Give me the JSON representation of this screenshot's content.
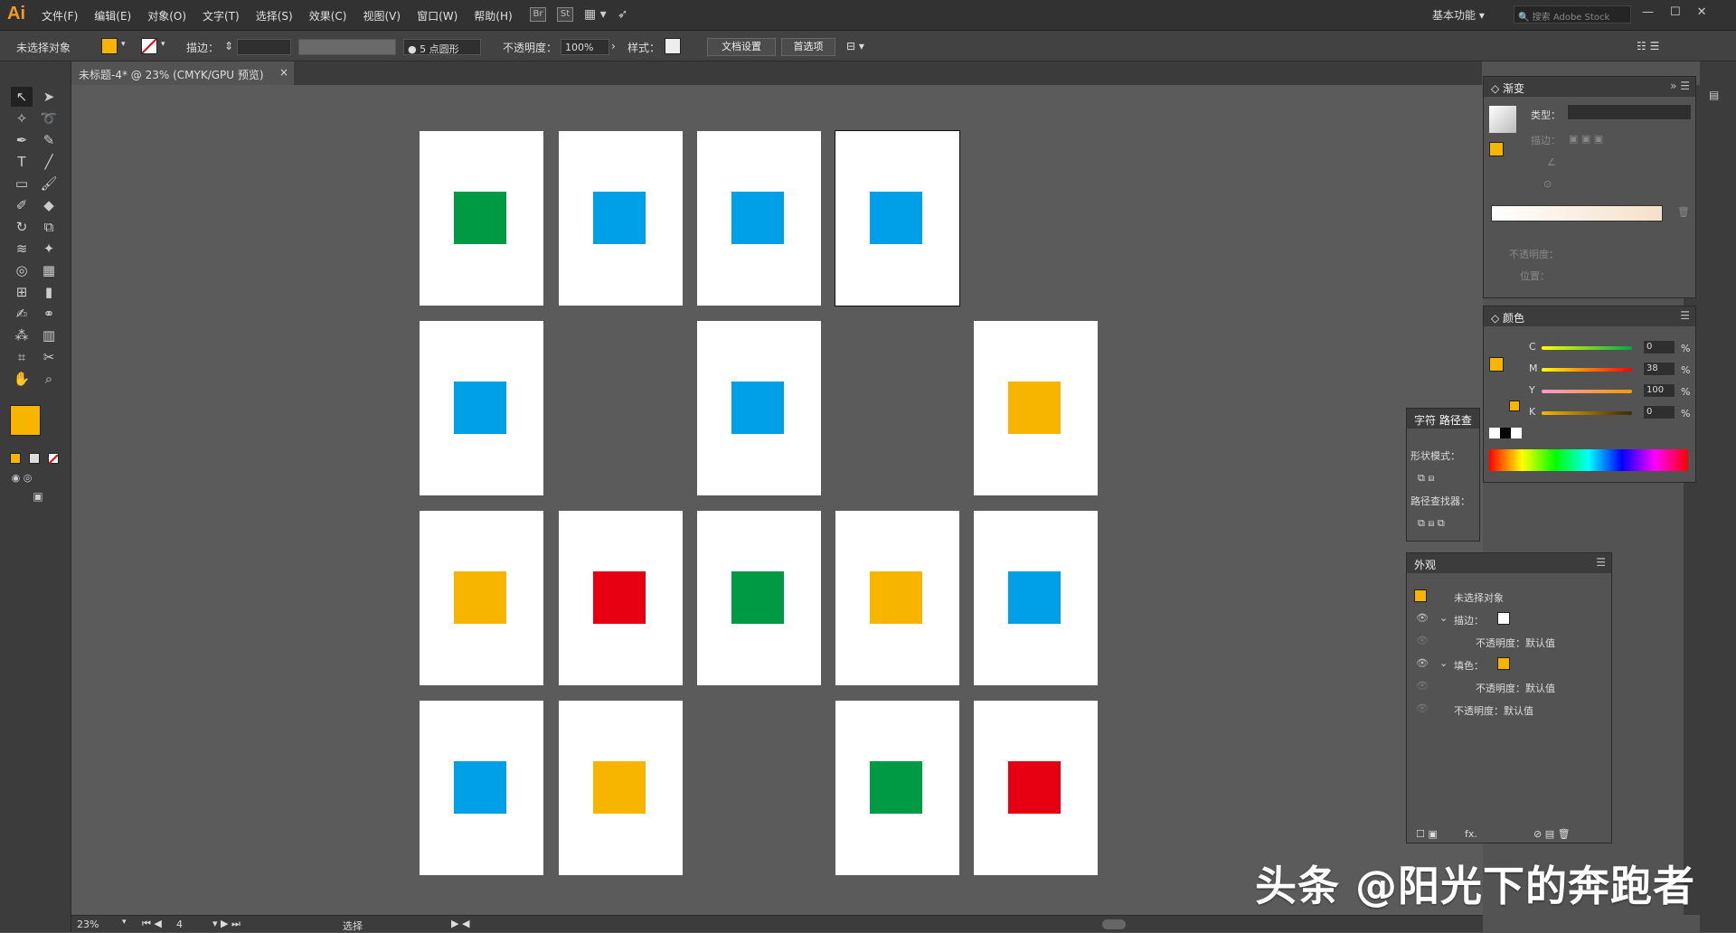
{
  "app": {
    "logo": "Ai"
  },
  "menu": [
    "文件(F)",
    "编辑(E)",
    "对象(O)",
    "文字(T)",
    "选择(S)",
    "效果(C)",
    "视图(V)",
    "窗口(W)",
    "帮助(H)"
  ],
  "menubar_icons": {
    "br": "Br",
    "st": "St"
  },
  "workspace": "基本功能",
  "search_placeholder": "搜索 Adobe Stock",
  "control": {
    "selection": "未选择对象",
    "stroke_label": "描边：",
    "brush": "● 5 点圆形",
    "opacity_label": "不透明度：",
    "opacity_value": "100%",
    "style_label": "样式：",
    "doc_setup": "文档设置",
    "prefs": "首选项"
  },
  "document_tab": {
    "title": "未标题-4* @ 23% (CMYK/GPU 预览)",
    "close": "×"
  },
  "colors": {
    "green": "#009944",
    "blue": "#00a0e9",
    "orange": "#f8b500",
    "red": "#e60012",
    "fill": "#f8b500"
  },
  "artboards": [
    {
      "color": "green"
    },
    {
      "color": "blue"
    },
    {
      "color": "blue"
    },
    {
      "color": "blue",
      "selected": true
    },
    {
      "color": "blue"
    },
    {
      "color": "blue"
    },
    {
      "color": "orange"
    },
    {
      "color": "orange"
    },
    {
      "color": "red"
    },
    {
      "color": "green"
    },
    {
      "color": "orange"
    },
    {
      "color": "blue"
    },
    {
      "color": "blue"
    },
    {
      "color": "orange"
    },
    {
      "color": "green"
    },
    {
      "color": "red"
    }
  ],
  "status": {
    "zoom": "23%",
    "page": "4",
    "tool": "选择"
  },
  "gradient_panel": {
    "title": "渐变",
    "type_label": "类型：",
    "stroke_label": "描边：",
    "opacity_label": "不透明度：",
    "position_label": "位置："
  },
  "color_panel": {
    "title": "颜色",
    "channels": [
      {
        "name": "C",
        "value": "0"
      },
      {
        "name": "M",
        "value": "38"
      },
      {
        "name": "Y",
        "value": "100"
      },
      {
        "name": "K",
        "value": "0"
      }
    ],
    "pct": "%"
  },
  "pathfinder_panel": {
    "tab_char": "字符",
    "tab_path": "路径查",
    "shape_modes": "形状模式：",
    "pathfinders": "路径查找器："
  },
  "appearance_panel": {
    "title": "外观",
    "object": "未选择对象",
    "stroke": "描边：",
    "stroke_opacity": "不透明度：默认值",
    "fill": "填色：",
    "fill_opacity": "不透明度：默认值",
    "opacity": "不透明度：默认值",
    "fx": "fx."
  },
  "watermark": "头条 @阳光下的奔跑者"
}
